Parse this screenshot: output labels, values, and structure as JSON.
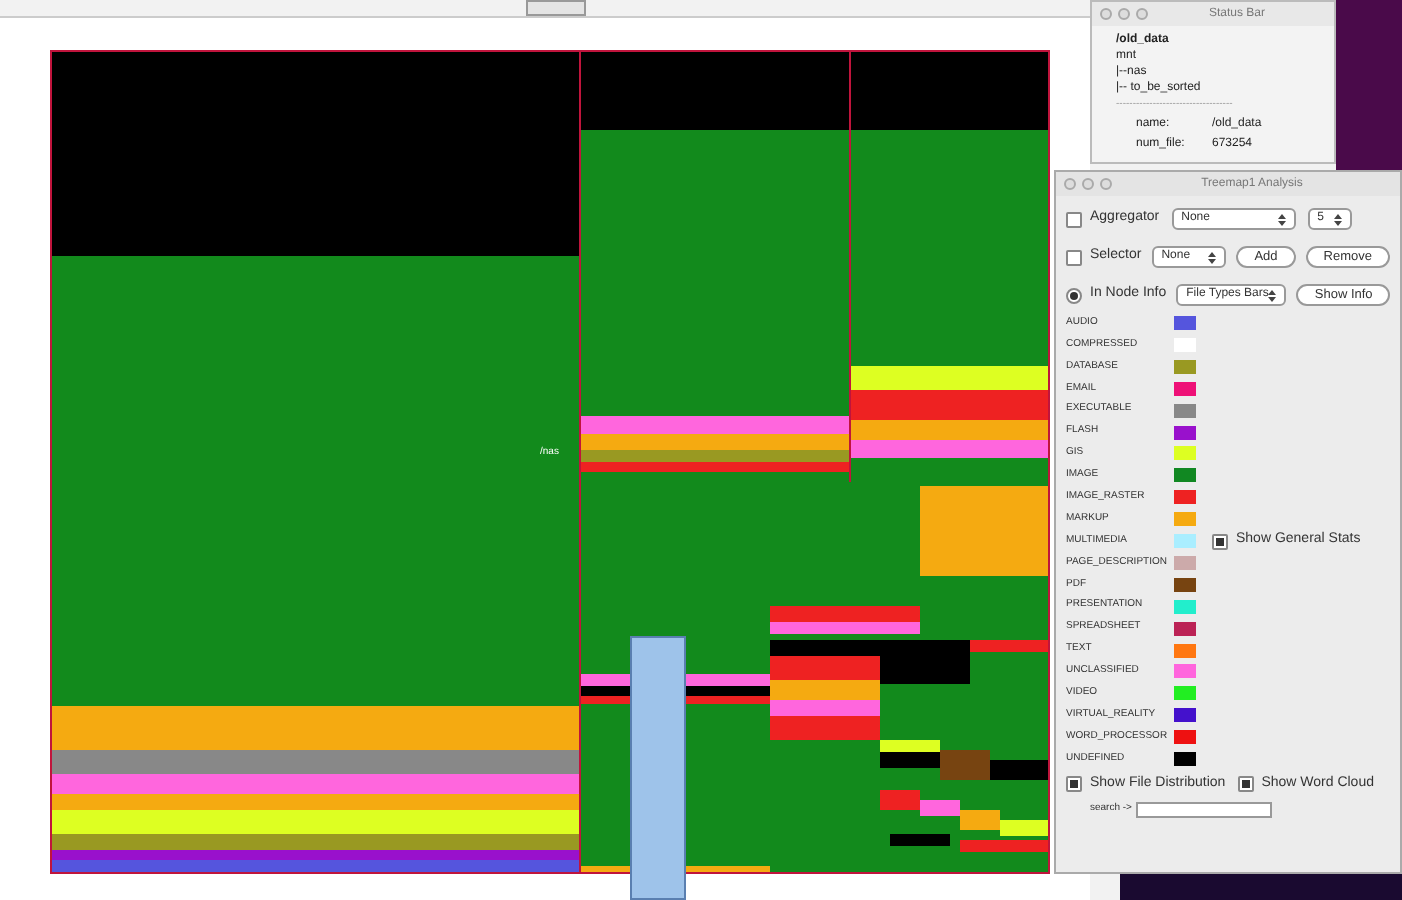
{
  "treemap": {
    "node_label": "/nas"
  },
  "status_bar": {
    "title": "Status Bar",
    "path": [
      "/old_data",
      "mnt",
      "|--nas",
      "|-- to_be_sorted"
    ],
    "separator": "-----------------------------------",
    "fields": [
      {
        "label": "name:",
        "value": "/old_data"
      },
      {
        "label": "num_file:",
        "value": "673254"
      }
    ]
  },
  "analysis": {
    "title": "Treemap1 Analysis",
    "aggregator": {
      "label": "Aggregator",
      "checked": false,
      "value": "None",
      "count": "5"
    },
    "selector": {
      "label": "Selector",
      "checked": false,
      "value": "None",
      "buttons": [
        "Add",
        "Remove"
      ]
    },
    "node_info": {
      "label": "In Node Info",
      "selected": true,
      "value": "File Types Bars",
      "button": "Show Info"
    },
    "legend": [
      {
        "label": "AUDIO",
        "color": "#5555dd"
      },
      {
        "label": "COMPRESSED",
        "color": "#ffffff"
      },
      {
        "label": "DATABASE",
        "color": "#999922"
      },
      {
        "label": "EMAIL",
        "color": "#ee1177"
      },
      {
        "label": "EXECUTABLE",
        "color": "#888888"
      },
      {
        "label": "FLASH",
        "color": "#9911cc"
      },
      {
        "label": "GIS",
        "color": "#ddff22"
      },
      {
        "label": "IMAGE",
        "color": "#118822"
      },
      {
        "label": "IMAGE_RASTER",
        "color": "#ee2222"
      },
      {
        "label": "MARKUP",
        "color": "#f5aa11"
      },
      {
        "label": "MULTIMEDIA",
        "color": "#aaeeff"
      },
      {
        "label": "PAGE_DESCRIPTION",
        "color": "#ccaaaa"
      },
      {
        "label": "PDF",
        "color": "#774411"
      },
      {
        "label": "PRESENTATION",
        "color": "#22eecc"
      },
      {
        "label": "SPREADSHEET",
        "color": "#bb2255"
      },
      {
        "label": "TEXT",
        "color": "#ff7711"
      },
      {
        "label": "UNCLASSIFIED",
        "color": "#ff66dd"
      },
      {
        "label": "VIDEO",
        "color": "#22ee22"
      },
      {
        "label": "VIRTUAL_REALITY",
        "color": "#4411cc"
      },
      {
        "label": "WORD_PROCESSOR",
        "color": "#ee1111"
      },
      {
        "label": "UNDEFINED",
        "color": "#000000"
      }
    ],
    "general_stats": {
      "label": "Show General Stats",
      "checked": true
    },
    "options": [
      {
        "label": "Show File Distribution",
        "checked": true
      },
      {
        "label": "Show Word Cloud",
        "checked": true
      }
    ],
    "search": {
      "label": "search ->"
    }
  }
}
